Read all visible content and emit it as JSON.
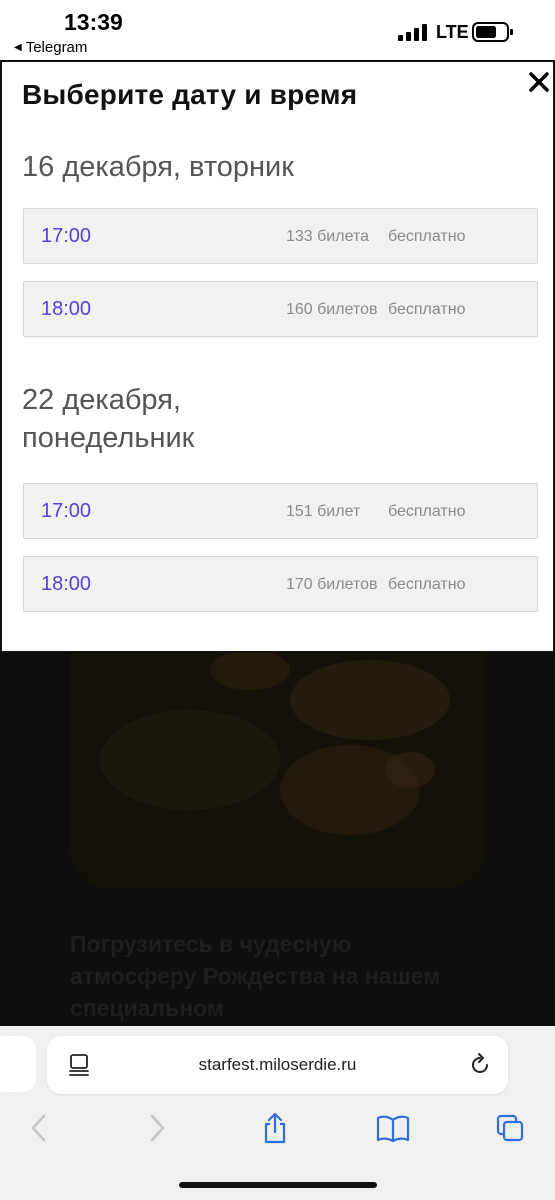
{
  "status_bar": {
    "time": "13:39",
    "back_app": "Telegram",
    "network": "LTE"
  },
  "modal": {
    "title": "Выберите дату и время",
    "dates": [
      {
        "heading": "16 декабря, вторник",
        "slots": [
          {
            "time": "17:00",
            "tickets": "133 билета",
            "price": "бесплатно"
          },
          {
            "time": "18:00",
            "tickets": "160 билетов",
            "price": "бесплатно"
          }
        ]
      },
      {
        "heading": "22 декабря, понедельник",
        "slots": [
          {
            "time": "17:00",
            "tickets": "151 билет",
            "price": "бесплатно"
          },
          {
            "time": "18:00",
            "tickets": "170 билетов",
            "price": "бесплатно"
          }
        ]
      }
    ]
  },
  "background_page": {
    "text": "Погрузитесь в чудесную атмосферу Рождества на нашем специальном"
  },
  "browser": {
    "url": "starfest.miloserdie.ru"
  },
  "icons": {
    "close": "close-icon",
    "page_menu": "page-menu-icon",
    "reload": "reload-icon",
    "back": "chevron-left-icon",
    "forward": "chevron-right-icon",
    "share": "share-icon",
    "bookmarks": "book-icon",
    "tabs": "tabs-icon"
  }
}
